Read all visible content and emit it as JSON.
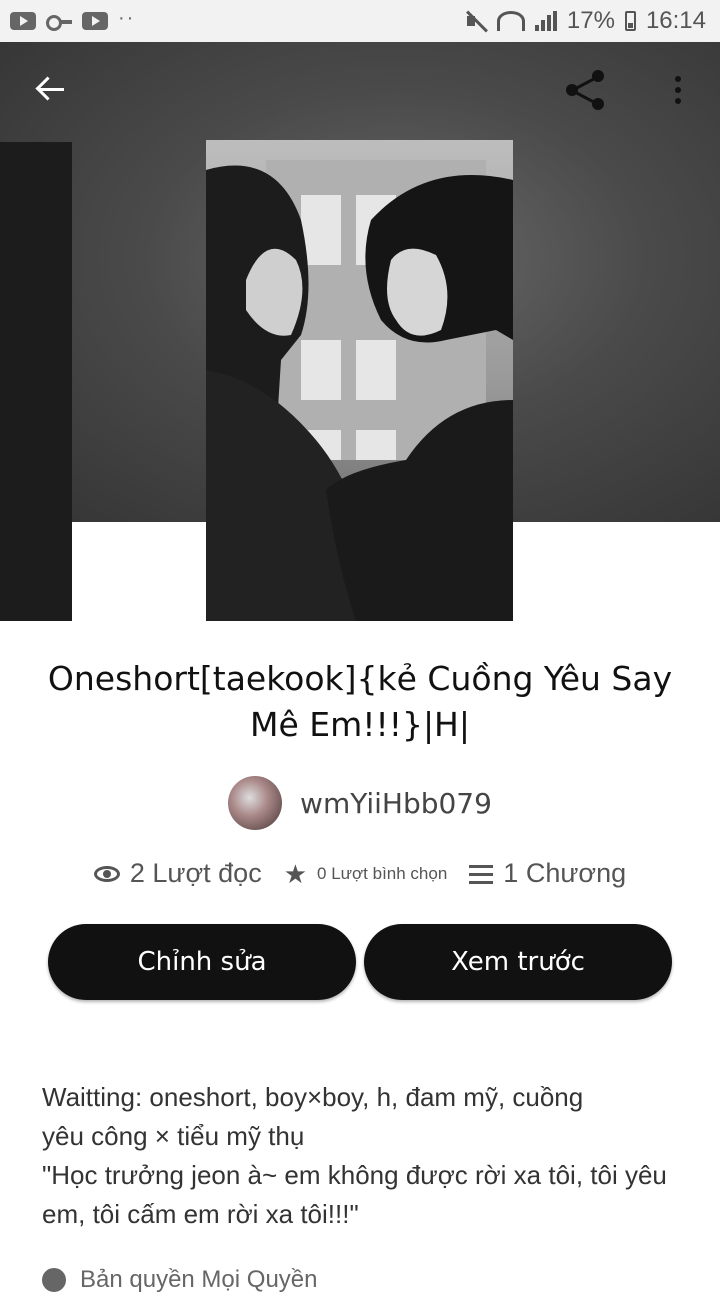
{
  "status_bar": {
    "battery": "17%",
    "time": "16:14"
  },
  "story": {
    "title": "Oneshort[taekook]{kẻ Cuồng Yêu Say Mê Em!!!}|H|",
    "author": "wmYiiHbb079"
  },
  "stats": {
    "reads": "2 Lượt đọc",
    "votes": "0 Lượt bình chọn",
    "parts": "1 Chương"
  },
  "actions": {
    "edit_label": "Chỉnh sửa",
    "preview_label": "Xem trước"
  },
  "description": {
    "line1": "Waitting: oneshort, boy×boy, h, đam mỹ, cuồng",
    "line2": "yêu công × tiểu mỹ thụ",
    "line3": "\"Học trưởng jeon à~ em không được rời xa tôi, tôi yêu em, tôi cấm em rời xa tôi!!!\""
  },
  "footer": {
    "peek_label": "Bản quyền Mọi Quyền"
  },
  "icons": [
    "youtube-icon",
    "key-icon",
    "mute-icon",
    "wifi-icon",
    "signal-icon",
    "battery-icon",
    "back-arrow-icon",
    "share-icon",
    "more-icon",
    "eye-icon",
    "star-icon",
    "list-icon",
    "copyright-icon"
  ]
}
